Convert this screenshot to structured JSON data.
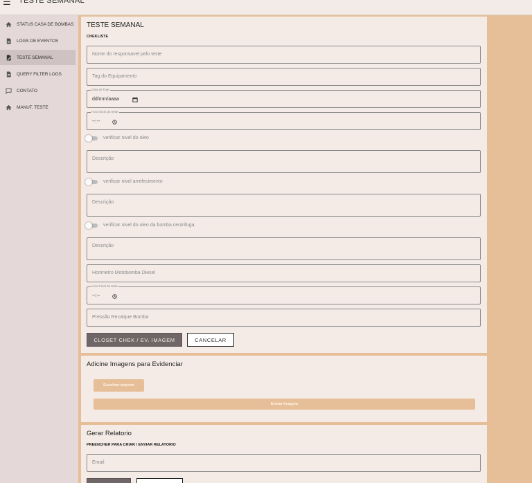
{
  "app": {
    "title": "TESTE SEMANAL"
  },
  "sidebar": {
    "items": [
      {
        "label": "STATUS CASA DE BOMBAS"
      },
      {
        "label": "LOGS DE EVENTOS"
      },
      {
        "label": "TESTE SEMANAL"
      },
      {
        "label": "QUERY FILTER LOGS"
      },
      {
        "label": "CONTATO"
      },
      {
        "label": "MANUT. TESTE"
      }
    ]
  },
  "form": {
    "title": "TESTE SEMANAL",
    "subtitle": "CHEKLISTE",
    "responsavel_placeholder": "Nome do responsavel pelo teste",
    "tag_placeholder": "Tag do Equipamento",
    "date_label": "Data de hoje",
    "date_value": "dd/mm/aaaa",
    "hora_inicio_label": "Hora inicio do teste",
    "hora_inicio_value": "--:--",
    "toggle1": "verificar nivel do oleo",
    "descricao1": "Descrição",
    "toggle2": "verificar nivel arrefecimento",
    "descricao2": "Descrição",
    "toggle3": "verificar nivel do oleo da bomba centrifuga",
    "descricao3": "Descrição",
    "horimetro_placeholder": "Horimetro Motobomba Diesel",
    "hora_final_label": "Hora Final do teste",
    "hora_final_value": "--:--",
    "pressao_placeholder": "Pressão Recalque Bomba",
    "submit_label": "CLOSET CHEK / EV. IMAGEM",
    "cancel_label": "CANCELAR"
  },
  "images": {
    "title": "Adicine Imagens para Evidenciar",
    "choose_label": "Escolher arquivo",
    "send_label": "Enviar Imagem"
  },
  "report": {
    "title": "Gerar Relatorio",
    "subtitle": "PREENCHER PARA CRIAR / ENVIAR RELATORIO",
    "email_placeholder": "Email"
  },
  "colors": {
    "background": "#e6bf98",
    "panel": "#f4ebe6",
    "sidebar": "#e4d9d8",
    "primary_button": "#6f6767"
  }
}
